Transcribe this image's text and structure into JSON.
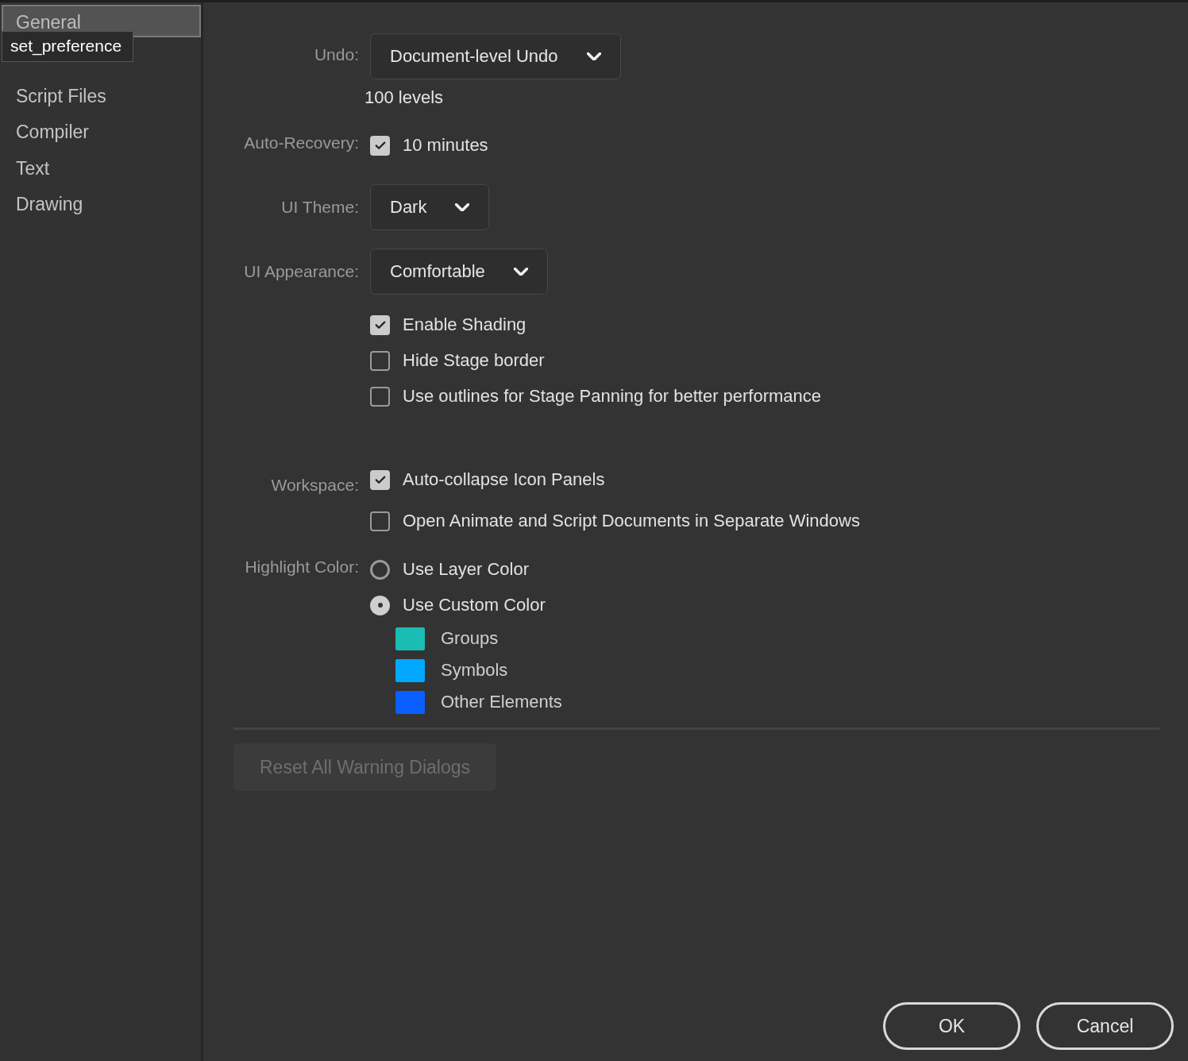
{
  "sidebar": {
    "items": [
      {
        "label": "General",
        "selected": true
      },
      {
        "label": "Script Files",
        "selected": false
      },
      {
        "label": "Compiler",
        "selected": false
      },
      {
        "label": "Text",
        "selected": false
      },
      {
        "label": "Drawing",
        "selected": false
      }
    ]
  },
  "tooltip": {
    "text": "set_preference"
  },
  "settings": [
    {
      "kind": "dropdown",
      "label": "Undo:",
      "value": "Document-level Undo",
      "note": "100 levels"
    },
    {
      "kind": "checkboxes",
      "label": "Auto-Recovery:",
      "items": [
        {
          "label": "10 minutes",
          "checked": true
        }
      ]
    },
    {
      "kind": "dropdown",
      "label": "UI Theme:",
      "value": "Dark"
    },
    {
      "kind": "dropdown",
      "label": "UI Appearance:",
      "value": "Comfortable"
    },
    {
      "kind": "checkboxes",
      "items": [
        {
          "label": "Enable Shading",
          "checked": true
        },
        {
          "label": "Hide Stage border",
          "checked": false
        },
        {
          "label": "Use outlines for Stage Panning for better performance",
          "checked": false
        }
      ]
    },
    {
      "kind": "checkboxes",
      "label": "Workspace:",
      "items": [
        {
          "label": "Auto-collapse Icon Panels",
          "checked": true
        },
        {
          "label": "Open Animate and Script Documents in Separate Windows",
          "checked": false
        }
      ]
    },
    {
      "kind": "radios",
      "label": "Highlight Color:",
      "options": [
        {
          "label": "Use Layer Color",
          "selected": false
        },
        {
          "label": "Use Custom Color",
          "selected": true
        }
      ],
      "swatches": [
        {
          "label": "Groups",
          "color": "#1abcb4"
        },
        {
          "label": "Symbols",
          "color": "#00a8ff"
        },
        {
          "label": "Other Elements",
          "color": "#0a5fff"
        }
      ]
    }
  ],
  "reset_button": {
    "label": "Reset All Warning Dialogs",
    "disabled": true
  },
  "buttons": [
    {
      "label": "OK"
    },
    {
      "label": "Cancel"
    }
  ]
}
